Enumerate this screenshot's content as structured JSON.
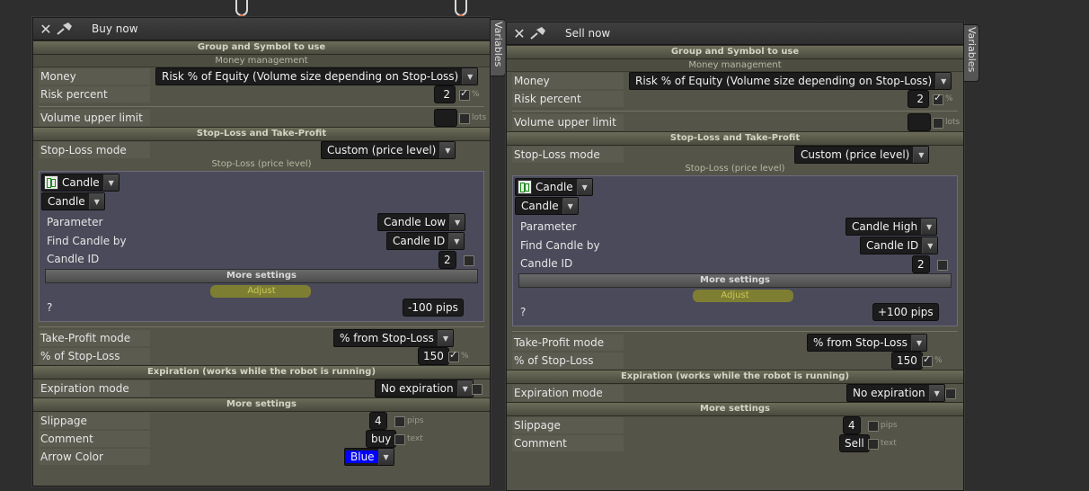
{
  "panels": [
    {
      "title": "Buy now",
      "variables_tab": "Variables",
      "group_header": "Group and Symbol to use",
      "money_header": "Money management",
      "money_management_label": "Money management",
      "money_management_value": "Risk % of Equity (Volume size depending on Stop-Loss)",
      "risk_percent_label": "Risk percent",
      "risk_percent_value": "2",
      "risk_percent_unit": "%",
      "volume_upper_limit_label": "Volume upper limit",
      "volume_upper_limit_value": "",
      "volume_upper_limit_unit": "lots",
      "sltp_header": "Stop-Loss and Take-Profit",
      "stop_loss_mode_label": "Stop-Loss mode",
      "stop_loss_mode_value": "Custom (price level)",
      "stop_loss_sub": "Stop-Loss (price level)",
      "candle_type_1": "Candle",
      "candle_type_2": "Candle",
      "parameter_label": "Parameter",
      "parameter_value": "Candle Low",
      "find_candle_label": "Find Candle by",
      "find_candle_value": "Candle ID",
      "candle_id_label": "Candle ID",
      "candle_id_value": "2",
      "more_settings_inner": "More settings",
      "adjust_label": "Adjust",
      "adjust_help": "?",
      "adjust_value": "-100 pips",
      "take_profit_mode_label": "Take-Profit mode",
      "take_profit_mode_value": "% from Stop-Loss",
      "pct_sl_label": "% of Stop-Loss",
      "pct_sl_value": "150",
      "pct_sl_unit": "%",
      "expiration_header": "Expiration (works while the robot is running)",
      "expiration_mode_label": "Expiration mode",
      "expiration_mode_value": "No expiration",
      "more_settings_header": "More settings",
      "slippage_label": "Slippage",
      "slippage_value": "4",
      "slippage_unit": "pips",
      "comment_label": "Comment",
      "comment_value": "buy",
      "comment_unit": "text",
      "arrow_color_label": "Arrow Color",
      "arrow_color_value": "Blue"
    },
    {
      "title": "Sell now",
      "variables_tab": "Variables",
      "group_header": "Group and Symbol to use",
      "money_header": "Money management",
      "money_management_label": "Money management",
      "money_management_value": "Risk % of Equity (Volume size depending on Stop-Loss)",
      "risk_percent_label": "Risk percent",
      "risk_percent_value": "2",
      "risk_percent_unit": "%",
      "volume_upper_limit_label": "Volume upper limit",
      "volume_upper_limit_value": "",
      "volume_upper_limit_unit": "lots",
      "sltp_header": "Stop-Loss and Take-Profit",
      "stop_loss_mode_label": "Stop-Loss mode",
      "stop_loss_mode_value": "Custom (price level)",
      "stop_loss_sub": "Stop-Loss (price level)",
      "candle_type_1": "Candle",
      "candle_type_2": "Candle",
      "parameter_label": "Parameter",
      "parameter_value": "Candle High",
      "find_candle_label": "Find Candle by",
      "find_candle_value": "Candle ID",
      "candle_id_label": "Candle ID",
      "candle_id_value": "2",
      "more_settings_inner": "More settings",
      "adjust_label": "Adjust",
      "adjust_help": "?",
      "adjust_value": "+100 pips",
      "take_profit_mode_label": "Take-Profit mode",
      "take_profit_mode_value": "% from Stop-Loss",
      "pct_sl_label": "% of Stop-Loss",
      "pct_sl_value": "150",
      "pct_sl_unit": "%",
      "expiration_header": "Expiration (works while the robot is running)",
      "expiration_mode_label": "Expiration mode",
      "expiration_mode_value": "No expiration",
      "more_settings_header": "More settings",
      "slippage_label": "Slippage",
      "slippage_value": "4",
      "slippage_unit": "pips",
      "comment_label": "Comment",
      "comment_value": "Sell",
      "comment_unit": "text"
    }
  ],
  "colors": {
    "panel_bg": "#545448",
    "section_bg": "#5f5f4e",
    "field_bg": "#1c1c1c",
    "highlight": "#aaaa14",
    "arrow_color_swatch": "#0000ff"
  }
}
